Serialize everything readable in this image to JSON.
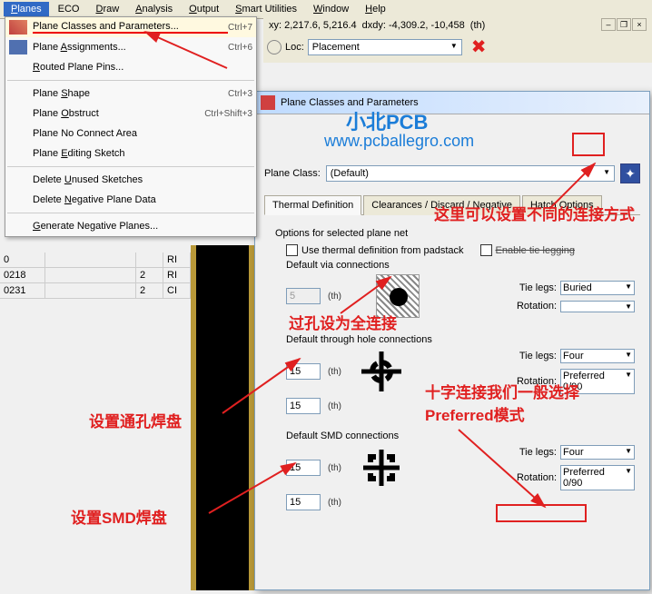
{
  "menubar": [
    "Planes",
    "ECO",
    "Draw",
    "Analysis",
    "Output",
    "Smart Utilities",
    "Window",
    "Help"
  ],
  "dropdown": {
    "items": [
      {
        "label": "Plane Classes and Parameters...",
        "shortcut": "Ctrl+7",
        "icon": "grid"
      },
      {
        "label": "Plane Assignments...",
        "shortcut": "Ctrl+6",
        "icon": "assign"
      },
      {
        "label": "Routed Plane Pins...",
        "shortcut": ""
      },
      {
        "sep": true
      },
      {
        "label": "Plane Shape",
        "shortcut": "Ctrl+3"
      },
      {
        "label": "Plane Obstruct",
        "shortcut": "Ctrl+Shift+3"
      },
      {
        "label": "Plane No Connect Area",
        "shortcut": ""
      },
      {
        "label": "Plane Editing Sketch",
        "shortcut": ""
      },
      {
        "sep": true
      },
      {
        "label": "Delete Unused Sketches",
        "shortcut": ""
      },
      {
        "label": "Delete Negative Plane Data",
        "shortcut": ""
      },
      {
        "sep": true
      },
      {
        "label": "Generate Negative Planes...",
        "shortcut": ""
      }
    ]
  },
  "coords": {
    "xy": "xy: 2,217.6, 5,216.4",
    "dxdy": "dxdy: -4,309.2, -10,458",
    "unit": "(th)"
  },
  "loc": {
    "label": "Loc:",
    "value": "Placement"
  },
  "grid_rows": [
    {
      "c1": "0",
      "c2": "",
      "c3": "",
      "c4": "RI"
    },
    {
      "c1": "0218",
      "c2": "",
      "c3": "2",
      "c4": "RI"
    },
    {
      "c1": "0231",
      "c2": "",
      "c3": "2",
      "c4": "CI"
    }
  ],
  "dialog": {
    "title": "Plane Classes and Parameters",
    "class_label": "Plane Class:",
    "class_value": "(Default)",
    "tabs": [
      "Thermal Definition",
      "Clearances / Discard / Negative",
      "Hatch Options"
    ],
    "opts_label": "Options for selected plane net",
    "chk1": "Use thermal definition from padstack",
    "chk2": "Enable tie legging",
    "via": {
      "title": "Default via connections",
      "val": "5",
      "th": "(th)",
      "tielegs_label": "Tie legs:",
      "tielegs": "Buried",
      "rot_label": "Rotation:",
      "rot": ""
    },
    "th": {
      "title": "Default through hole connections",
      "val1": "15",
      "val2": "15",
      "th": "(th)",
      "tielegs_label": "Tie legs:",
      "tielegs": "Four",
      "rot_label": "Rotation:",
      "rot": "Preferred 0/90"
    },
    "smd": {
      "title": "Default SMD connections",
      "val1": "15",
      "val2": "15",
      "th": "(th)",
      "tielegs_label": "Tie legs:",
      "tielegs": "Four",
      "rot_label": "Rotation:",
      "rot": "Preferred 0/90"
    }
  },
  "annotations": {
    "a1": "这里可以设置不同的连接方式",
    "a2": "过孔设为全连接",
    "a3": "设置通孔焊盘",
    "a4": "十字连接我们一般选择Preferred模式",
    "a5": "设置SMD焊盘",
    "wm1": "小北PCB",
    "wm2": "www.pcballegro.com"
  }
}
